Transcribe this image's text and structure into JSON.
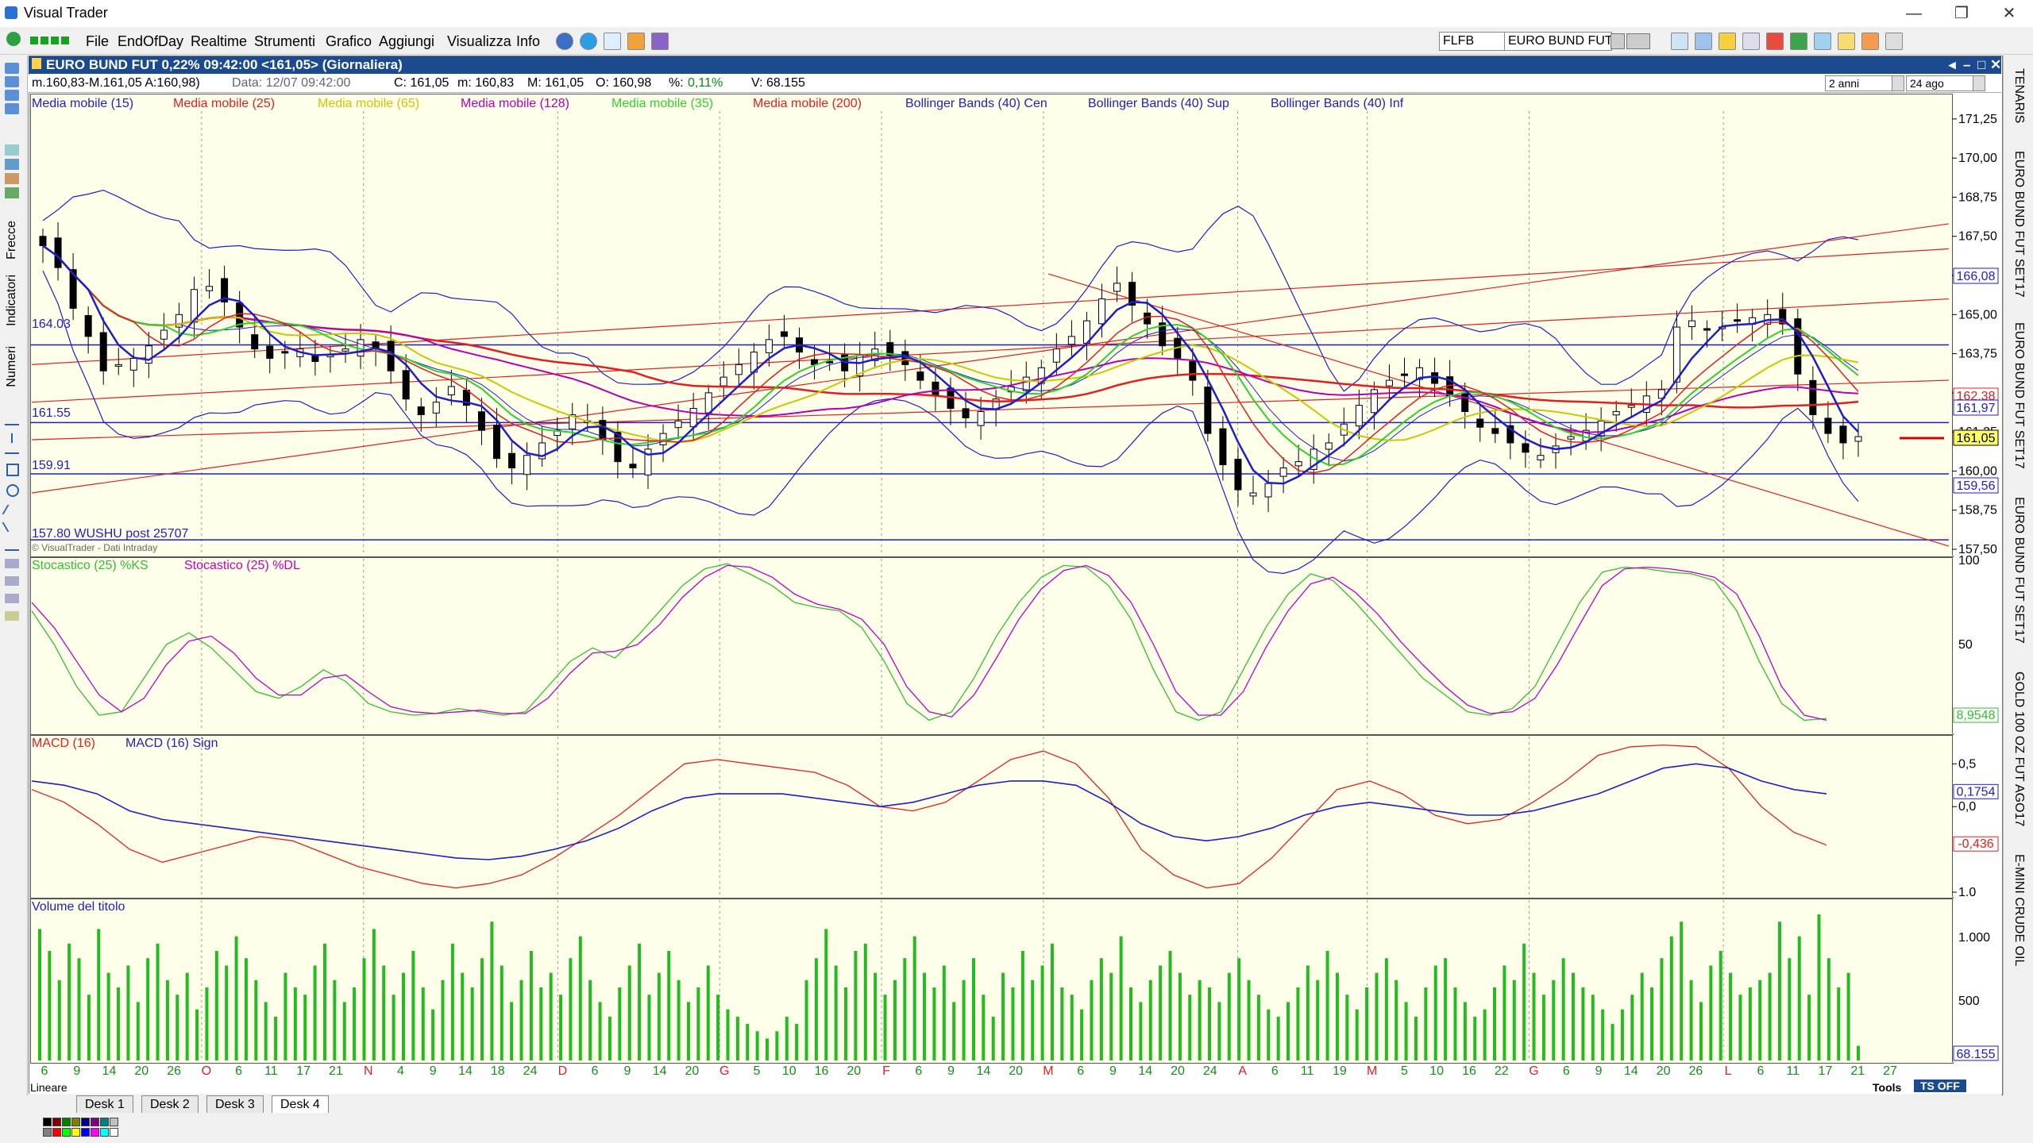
{
  "app": {
    "title": "Visual Trader"
  },
  "menu": [
    "File",
    "EndOfDay",
    "Realtime",
    "Strumenti",
    "Grafico",
    "Aggiungi",
    "Visualizza",
    "Info"
  ],
  "toolbar": {
    "symbol_short": "FLFB",
    "symbol_full": "EURO BUND FUT"
  },
  "left_panel": {
    "labels": [
      "Frecce",
      "Indicatori",
      "Numeri"
    ]
  },
  "right_tabs": [
    "TENARIS",
    "EURO BUND FUT SET17",
    "EURO BUND FUT SET17",
    "EURO BUND FUT SET17",
    "GOLD 100 OZ FUT AGO17",
    "E-MINI CRUDE OIL"
  ],
  "chart_window": {
    "title": "EURO BUND FUT 0,22% 09:42:00  <161,05> (Giornaliera)",
    "info": {
      "range": "m.160,83-M.161,05 A:160,98)",
      "data": "Data: 12/07 09:42:00",
      "close": "C: 161,05",
      "min": "m: 160,83",
      "max": "M: 161,05",
      "open": "O: 160,98",
      "pct_label": "%:",
      "pct_value": "0,11%",
      "vol": "V: 68.155",
      "period": "2 anni",
      "date": "24 ago"
    },
    "copyright": "© VisualTrader - Dati Intraday"
  },
  "legend": [
    {
      "text": "Media mobile (15)",
      "color": "#1e1ec8"
    },
    {
      "text": "Media mobile (25)",
      "color": "#e02020"
    },
    {
      "text": "Media mobile (65)",
      "color": "#c8c800"
    },
    {
      "text": "Media mobile (128)",
      "color": "#b400b4"
    },
    {
      "text": "Media mobile (35)",
      "color": "#30d030"
    },
    {
      "text": "Media mobile (200)",
      "color": "#e02020"
    },
    {
      "text": "Bollinger Bands (40) Cen",
      "color": "#1e1ec8"
    },
    {
      "text": "Bollinger Bands (40) Sup",
      "color": "#1e1ec8"
    },
    {
      "text": "Bollinger Bands (40) Inf",
      "color": "#1e1ec8"
    }
  ],
  "price_levels": [
    {
      "label": "164.03",
      "value": 164.03
    },
    {
      "label": "161.55",
      "value": 161.55
    },
    {
      "label": "159.91",
      "value": 159.91
    },
    {
      "label": "157.80 WUSHU post 25707",
      "value": 157.8
    }
  ],
  "stoch_legend": [
    {
      "text": "Stocastico (25) %KS",
      "color": "#30c030"
    },
    {
      "text": "Stocastico (25) %DL",
      "color": "#c000c0"
    }
  ],
  "macd_legend": [
    {
      "text": "MACD (16)",
      "color": "#e02020"
    },
    {
      "text": "MACD (16) Sign",
      "color": "#1e1ec8"
    }
  ],
  "volume_legend": "Volume del titolo",
  "chart_data": [
    {
      "type": "candlestick",
      "title": "EURO BUND FUT",
      "y_axis_ticks": [
        "171,25",
        "170,00",
        "168,75",
        "167,50",
        "166,25",
        "165,00",
        "163,75",
        "162,50",
        "161,25",
        "160,00",
        "158,75",
        "157,50"
      ],
      "ylim": [
        157.5,
        171.5
      ],
      "highlighted_values": [
        {
          "label": "166,08",
          "color": "#1e1ec8"
        },
        {
          "label": "162,38",
          "color": "#e02020"
        },
        {
          "label": "161,97",
          "color": "#1e1ec8"
        },
        {
          "label": "161,05",
          "color": "#000000"
        },
        {
          "label": "159,56",
          "color": "#1e1ec8"
        }
      ],
      "close_series": [
        167.2,
        166.5,
        165.2,
        164.3,
        163.2,
        163.4,
        163.6,
        164.0,
        164.5,
        165.0,
        165.8,
        165.9,
        165.4,
        164.6,
        163.9,
        163.6,
        163.8,
        163.9,
        163.5,
        163.7,
        163.9,
        164.2,
        163.9,
        163.2,
        162.3,
        161.8,
        162.2,
        162.7,
        162.1,
        161.3,
        160.4,
        160.1,
        160.5,
        160.9,
        161.3,
        161.8,
        161.6,
        161.0,
        160.3,
        160.1,
        160.7,
        161.2,
        161.6,
        162.0,
        162.5,
        163.0,
        163.4,
        163.8,
        164.2,
        164.3,
        163.8,
        163.4,
        163.5,
        163.2,
        163.7,
        163.9,
        163.7,
        163.4,
        162.9,
        162.4,
        162.0,
        161.7,
        161.9,
        162.3,
        162.7,
        163.0,
        163.3,
        163.9,
        164.3,
        164.8,
        165.5,
        166.0,
        165.3,
        164.7,
        164.0,
        163.6,
        162.9,
        161.2,
        160.2,
        159.4,
        159.3,
        159.6,
        160.1,
        160.3,
        160.7,
        160.9,
        161.5,
        162.1,
        162.6,
        162.9,
        163.1,
        163.3,
        162.8,
        162.4,
        161.9,
        161.4,
        161.2,
        160.9,
        160.6,
        160.5,
        160.8,
        161.1,
        161.3,
        161.6,
        161.9,
        162.1,
        162.4,
        162.6,
        164.6,
        164.8,
        164.5,
        164.6,
        164.8,
        164.9,
        165.0,
        164.7,
        163.1,
        161.8,
        161.2,
        160.9,
        161.1
      ],
      "x_ticks": [
        "6",
        "9",
        "14",
        "20",
        "26",
        "O",
        "6",
        "11",
        "17",
        "21",
        "N",
        "4",
        "9",
        "14",
        "18",
        "24",
        "D",
        "6",
        "9",
        "14",
        "20",
        "G",
        "5",
        "10",
        "16",
        "20",
        "F",
        "6",
        "9",
        "14",
        "20",
        "M",
        "6",
        "9",
        "14",
        "20",
        "24",
        "A",
        "6",
        "11",
        "19",
        "M",
        "5",
        "10",
        "16",
        "22",
        "G",
        "6",
        "9",
        "14",
        "20",
        "26",
        "L",
        "6",
        "11",
        "17",
        "21",
        "27"
      ]
    },
    {
      "type": "line",
      "title": "Stocastico (25)",
      "y_axis_ticks": [
        "100",
        "50"
      ],
      "ylim": [
        0,
        100
      ],
      "current_value": "8,9548",
      "series": [
        {
          "name": "Stocastico (25) %KS",
          "values": [
            70,
            50,
            25,
            8,
            10,
            30,
            50,
            57,
            48,
            35,
            22,
            18,
            25,
            35,
            28,
            15,
            10,
            8,
            9,
            12,
            10,
            8,
            10,
            25,
            40,
            48,
            42,
            55,
            70,
            85,
            95,
            98,
            92,
            85,
            75,
            72,
            70,
            60,
            40,
            15,
            5,
            10,
            30,
            55,
            75,
            90,
            97,
            96,
            85,
            65,
            35,
            10,
            5,
            10,
            35,
            60,
            80,
            92,
            88,
            75,
            60,
            45,
            30,
            20,
            10,
            8,
            12,
            25,
            50,
            75,
            93,
            96,
            95,
            93,
            92,
            88,
            70,
            40,
            15,
            5,
            6
          ]
        },
        {
          "name": "Stocastico (25) %DL",
          "values": [
            75,
            60,
            40,
            20,
            10,
            18,
            38,
            52,
            55,
            45,
            30,
            20,
            20,
            30,
            32,
            22,
            13,
            10,
            9,
            10,
            11,
            9,
            9,
            18,
            33,
            45,
            46,
            50,
            62,
            78,
            90,
            97,
            96,
            90,
            80,
            74,
            71,
            65,
            50,
            25,
            10,
            7,
            20,
            42,
            65,
            83,
            94,
            97,
            91,
            75,
            50,
            22,
            8,
            8,
            22,
            48,
            70,
            86,
            90,
            81,
            68,
            52,
            38,
            25,
            14,
            9,
            10,
            18,
            38,
            62,
            85,
            95,
            96,
            95,
            93,
            90,
            80,
            55,
            25,
            8,
            5
          ]
        }
      ]
    },
    {
      "type": "line",
      "title": "MACD (16)",
      "y_axis_ticks": [
        "0,5",
        "0,0",
        "1.0"
      ],
      "ylim": [
        -1.0,
        0.8
      ],
      "highlighted_values": [
        {
          "label": "0,1754",
          "color": "#1e1ec8"
        },
        {
          "label": "-0,436",
          "color": "#e02020"
        }
      ],
      "series": [
        {
          "name": "MACD (16)",
          "values": [
            0.2,
            0.05,
            -0.2,
            -0.5,
            -0.65,
            -0.55,
            -0.45,
            -0.35,
            -0.4,
            -0.55,
            -0.7,
            -0.8,
            -0.9,
            -0.95,
            -0.9,
            -0.8,
            -0.6,
            -0.35,
            -0.1,
            0.2,
            0.5,
            0.55,
            0.5,
            0.45,
            0.4,
            0.25,
            0.0,
            -0.05,
            0.05,
            0.3,
            0.55,
            0.65,
            0.5,
            0.1,
            -0.5,
            -0.8,
            -0.95,
            -0.9,
            -0.6,
            -0.2,
            0.2,
            0.3,
            0.15,
            -0.1,
            -0.2,
            -0.15,
            0.05,
            0.3,
            0.6,
            0.7,
            0.72,
            0.7,
            0.45,
            0.0,
            -0.3,
            -0.45
          ]
        },
        {
          "name": "MACD (16) Sign",
          "values": [
            0.3,
            0.25,
            0.15,
            -0.05,
            -0.15,
            -0.2,
            -0.25,
            -0.3,
            -0.35,
            -0.4,
            -0.45,
            -0.5,
            -0.55,
            -0.6,
            -0.62,
            -0.58,
            -0.5,
            -0.4,
            -0.25,
            -0.05,
            0.1,
            0.15,
            0.15,
            0.15,
            0.1,
            0.05,
            0.0,
            0.05,
            0.15,
            0.25,
            0.3,
            0.3,
            0.25,
            0.05,
            -0.2,
            -0.35,
            -0.4,
            -0.35,
            -0.25,
            -0.1,
            0.0,
            0.05,
            0.0,
            -0.05,
            -0.1,
            -0.1,
            -0.05,
            0.05,
            0.15,
            0.3,
            0.45,
            0.5,
            0.45,
            0.3,
            0.2,
            0.15
          ]
        }
      ]
    },
    {
      "type": "bar",
      "title": "Volume del titolo",
      "y_axis_ticks": [
        "1.000",
        "500"
      ],
      "current_value": "68.155",
      "values": [
        0.9,
        0.75,
        0.55,
        0.8,
        0.7,
        0.45,
        0.9,
        0.6,
        0.5,
        0.65,
        0.4,
        0.7,
        0.8,
        0.55,
        0.45,
        0.6,
        0.35,
        0.5,
        0.75,
        0.65,
        0.85,
        0.7,
        0.55,
        0.4,
        0.3,
        0.6,
        0.5,
        0.45,
        0.65,
        0.8,
        0.55,
        0.4,
        0.5,
        0.7,
        0.9,
        0.65,
        0.45,
        0.6,
        0.75,
        0.5,
        0.35,
        0.55,
        0.8,
        0.6,
        0.5,
        0.7,
        0.95,
        0.65,
        0.4,
        0.55,
        0.75,
        0.5,
        0.6,
        0.45,
        0.7,
        0.85,
        0.55,
        0.4,
        0.3,
        0.5,
        0.65,
        0.8,
        0.45,
        0.6,
        0.75,
        0.55,
        0.4,
        0.5,
        0.65,
        0.45,
        0.35,
        0.3,
        0.25,
        0.2,
        0.15,
        0.2,
        0.3,
        0.25,
        0.55,
        0.7,
        0.9,
        0.65,
        0.5,
        0.75,
        0.8,
        0.6,
        0.45,
        0.55,
        0.7,
        0.85,
        0.6,
        0.5,
        0.65,
        0.4,
        0.55,
        0.7,
        0.45,
        0.3,
        0.6,
        0.5,
        0.75,
        0.55,
        0.65,
        0.8,
        0.5,
        0.45,
        0.35,
        0.55,
        0.7,
        0.6,
        0.85,
        0.5,
        0.4,
        0.55,
        0.65,
        0.75,
        0.6,
        0.45,
        0.55,
        0.5,
        0.4,
        0.6,
        0.7,
        0.55,
        0.45,
        0.35,
        0.3,
        0.4,
        0.5,
        0.65,
        0.55,
        0.75,
        0.6,
        0.45,
        0.35,
        0.5,
        0.6,
        0.7,
        0.55,
        0.4,
        0.3,
        0.5,
        0.65,
        0.7,
        0.5,
        0.4,
        0.3,
        0.35,
        0.5,
        0.65,
        0.55,
        0.8,
        0.6,
        0.45,
        0.55,
        0.7,
        0.6,
        0.5,
        0.45,
        0.35,
        0.25,
        0.35,
        0.45,
        0.6,
        0.5,
        0.7,
        0.85,
        0.95,
        0.55,
        0.4,
        0.65,
        0.75,
        0.6,
        0.45,
        0.5,
        0.55,
        0.6,
        0.95,
        0.7,
        0.85,
        0.45,
        1.0,
        0.7,
        0.5,
        0.6,
        0.1
      ]
    }
  ],
  "bottom": {
    "left_label": "Lineare",
    "desks": [
      "Desk 1",
      "Desk 2",
      "Desk 3",
      "Desk 4"
    ],
    "tools": "Tools",
    "ts_button": "TS OFF"
  },
  "palette_colors": [
    "#000000",
    "#800000",
    "#008000",
    "#808000",
    "#000080",
    "#800080",
    "#008080",
    "#c0c0c0",
    "#808080",
    "#ff0000",
    "#00ff00",
    "#ffff00",
    "#0000ff",
    "#ff00ff",
    "#00ffff",
    "#ffffff"
  ]
}
